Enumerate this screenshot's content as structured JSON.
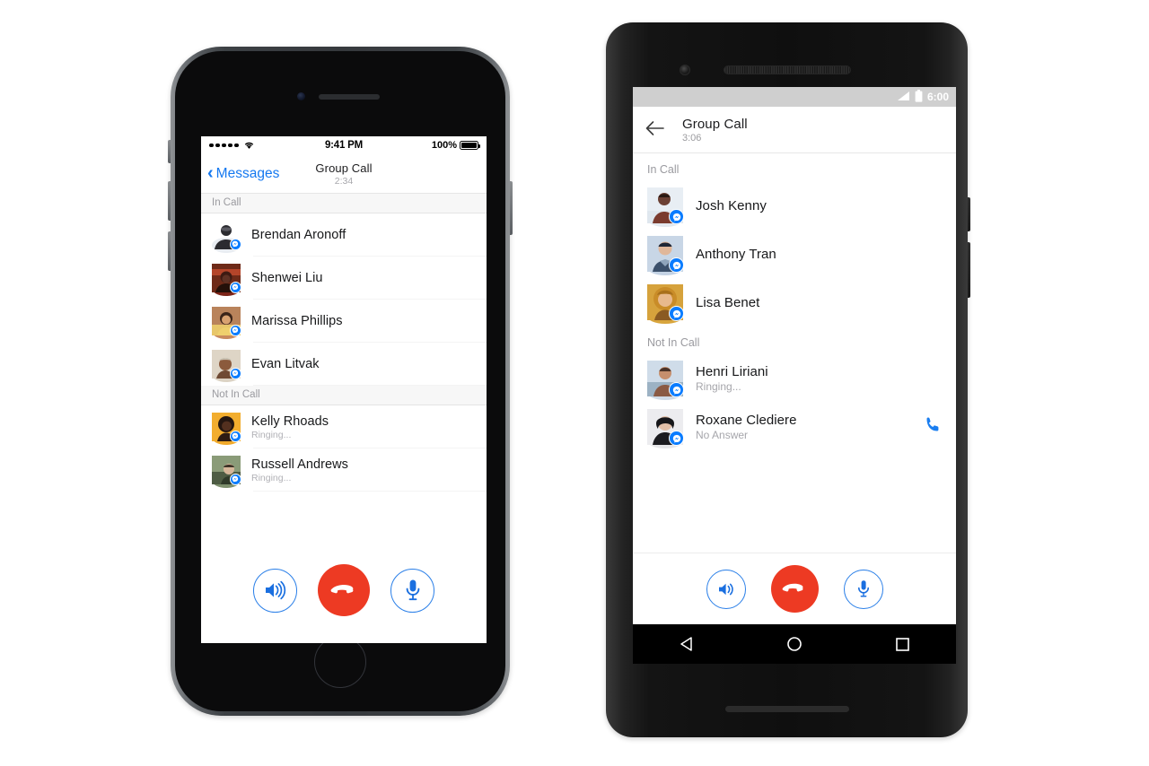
{
  "scene": {
    "description": "Facebook Messenger group call screen shown on an iPhone and an Android phone",
    "accent_blue": "#0a7cff",
    "outline_blue": "#2a7fe8",
    "danger_red": "#ed3a23",
    "section_bg_ios": "#f7f7f7",
    "muted_text": "#a8a8ad"
  },
  "iphone": {
    "device_name": "iPhone",
    "status_bar": {
      "signal_dots": 5,
      "wifi_icon": "wifi-icon",
      "time": "9:41 PM",
      "battery_percent": "100%",
      "battery_icon": "battery-full-icon"
    },
    "nav": {
      "back_icon": "chevron-left-icon",
      "back_label": "Messages",
      "title": "Group Call",
      "subtitle": "2:34"
    },
    "sections": [
      {
        "header": "In Call",
        "rows": [
          {
            "name": "Brendan Aronoff",
            "status": "",
            "avatar_bg": "#e9edf2",
            "avatar_tone": "#2b2b30",
            "badge": "messenger-badge-icon"
          },
          {
            "name": "Shenwei Liu",
            "status": "",
            "avatar_bg": "#7c2418",
            "avatar_tone": "#3a1510",
            "badge": "messenger-badge-icon"
          },
          {
            "name": "Marissa Phillips",
            "status": "",
            "avatar_bg": "#c98b5e",
            "avatar_tone": "#e8c76a",
            "badge": "messenger-badge-icon"
          },
          {
            "name": "Evan Litvak",
            "status": "",
            "avatar_bg": "#dcd3c4",
            "avatar_tone": "#8b5a3c",
            "badge": "messenger-badge-icon"
          }
        ]
      },
      {
        "header": "Not In Call",
        "rows": [
          {
            "name": "Kelly Rhoads",
            "status": "Ringing...",
            "avatar_bg": "#f0a92a",
            "avatar_tone": "#2b1a12",
            "badge": "messenger-badge-icon"
          },
          {
            "name": "Russell Andrews",
            "status": "Ringing...",
            "avatar_bg": "#7d8f6d",
            "avatar_tone": "#3e4a39",
            "badge": "messenger-badge-icon"
          }
        ]
      }
    ],
    "controls": [
      {
        "name": "speaker-button",
        "icon": "speaker-loud-icon",
        "style": "outline",
        "label": "Speaker"
      },
      {
        "name": "end-call-button",
        "icon": "phone-hangup-icon",
        "style": "danger",
        "label": "End Call"
      },
      {
        "name": "mute-button",
        "icon": "microphone-icon",
        "style": "outline",
        "label": "Mute"
      }
    ]
  },
  "android": {
    "device_name": "Android",
    "status_bar": {
      "signal_icon": "signal-bars-icon",
      "battery_icon": "battery-icon",
      "time": "6:00"
    },
    "appbar": {
      "back_icon": "arrow-left-icon",
      "title": "Group Call",
      "subtitle": "3:06"
    },
    "sections": [
      {
        "header": "In Call",
        "rows": [
          {
            "name": "Josh Kenny",
            "status": "",
            "action_icon": "",
            "avatar_bg": "#e3e9ef",
            "avatar_tone": "#7a3b2e",
            "badge": "messenger-badge-icon"
          },
          {
            "name": "Anthony Tran",
            "status": "",
            "action_icon": "",
            "avatar_bg": "#c3d2e4",
            "avatar_tone": "#2b3b52",
            "badge": "messenger-badge-icon"
          },
          {
            "name": "Lisa Benet",
            "status": "",
            "action_icon": "",
            "avatar_bg": "#d8a53d",
            "avatar_tone": "#7a4a20",
            "badge": "messenger-badge-icon"
          }
        ]
      },
      {
        "header": "Not In Call",
        "rows": [
          {
            "name": "Henri Liriani",
            "status": "Ringing...",
            "action_icon": "",
            "avatar_bg": "#cfdae6",
            "avatar_tone": "#8a5a44",
            "badge": "messenger-badge-icon"
          },
          {
            "name": "Roxane Clediere",
            "status": "No Answer",
            "action_icon": "phone-call-icon",
            "avatar_bg": "#e6e6e8",
            "avatar_tone": "#1e1e22",
            "badge": "messenger-badge-icon"
          }
        ]
      }
    ],
    "controls": [
      {
        "name": "speaker-button",
        "icon": "speaker-loud-icon",
        "style": "outline",
        "label": "Speaker"
      },
      {
        "name": "end-call-button",
        "icon": "phone-hangup-icon",
        "style": "danger",
        "label": "End Call"
      },
      {
        "name": "mute-button",
        "icon": "microphone-icon",
        "style": "outline",
        "label": "Mute"
      }
    ],
    "nav_buttons": [
      {
        "name": "back-nav-button",
        "icon": "triangle-back-icon"
      },
      {
        "name": "home-nav-button",
        "icon": "circle-home-icon"
      },
      {
        "name": "recents-nav-button",
        "icon": "square-recents-icon"
      }
    ]
  }
}
